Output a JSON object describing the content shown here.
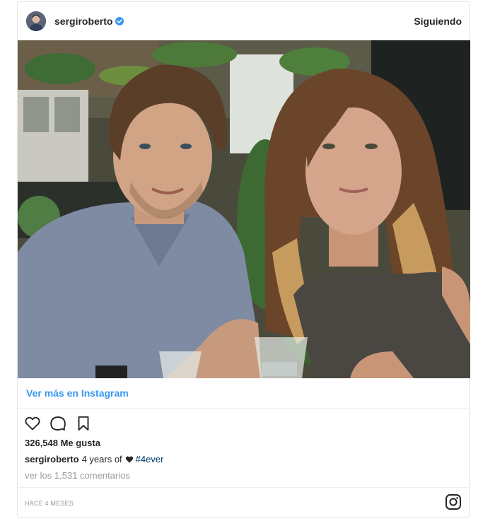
{
  "post": {
    "username": "sergiroberto",
    "verified": true,
    "follow_label": "Siguiendo",
    "view_more_label": "Ver más en Instagram",
    "likes_label": "326,548 Me gusta",
    "caption": {
      "user": "sergiroberto",
      "text": "4 years of",
      "hashtag": "#4ever"
    },
    "comments_label": "ver los 1,531 comentarios",
    "timestamp": "HACE 4 MESES"
  },
  "icons": {
    "verified": "verified-badge-icon",
    "like": "heart-outline-icon",
    "comment": "comment-bubble-icon",
    "save": "bookmark-icon",
    "caption_heart": "heart-filled-icon",
    "brand": "instagram-logo-icon"
  },
  "colors": {
    "link_blue": "#3897f0",
    "hashtag": "#003569",
    "muted": "#999999",
    "text": "#262626"
  }
}
